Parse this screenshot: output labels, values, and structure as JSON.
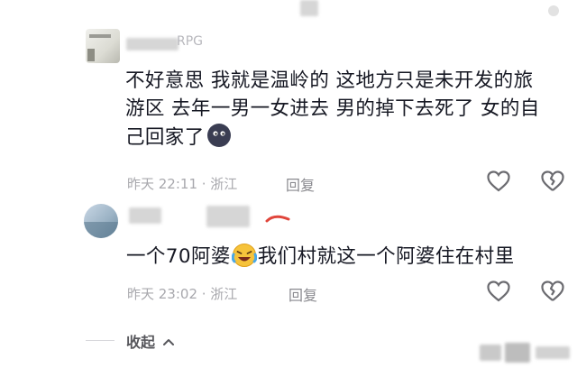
{
  "comments": [
    {
      "username": "RPG",
      "text": "不好意思 我就是温岭的 这地方只是未开发的旅游区 去年一男一女进去 男的掉下去死了 女的自己回家了",
      "line1": "不好意思 我就是温岭的 这地方只是未开发的旅",
      "line2": "游区 去年一男一女进去 男的掉下去死了 女的自",
      "line3": "己回家了",
      "emoji": "dark-face-emoji",
      "timestamp": "昨天 22:11 · 浙江",
      "reply_label": "回复"
    },
    {
      "text_before": "一个70阿婆",
      "emoji": "laughing-crying-emoji",
      "text_after": "我们村就这一个阿婆住在村里",
      "timestamp": "昨天 23:02 · 浙江",
      "reply_label": "回复"
    }
  ],
  "collapse_label": "收起",
  "colors": {
    "text": "#161823",
    "meta": "#a8a8ad",
    "icon": "#6b6b70"
  }
}
